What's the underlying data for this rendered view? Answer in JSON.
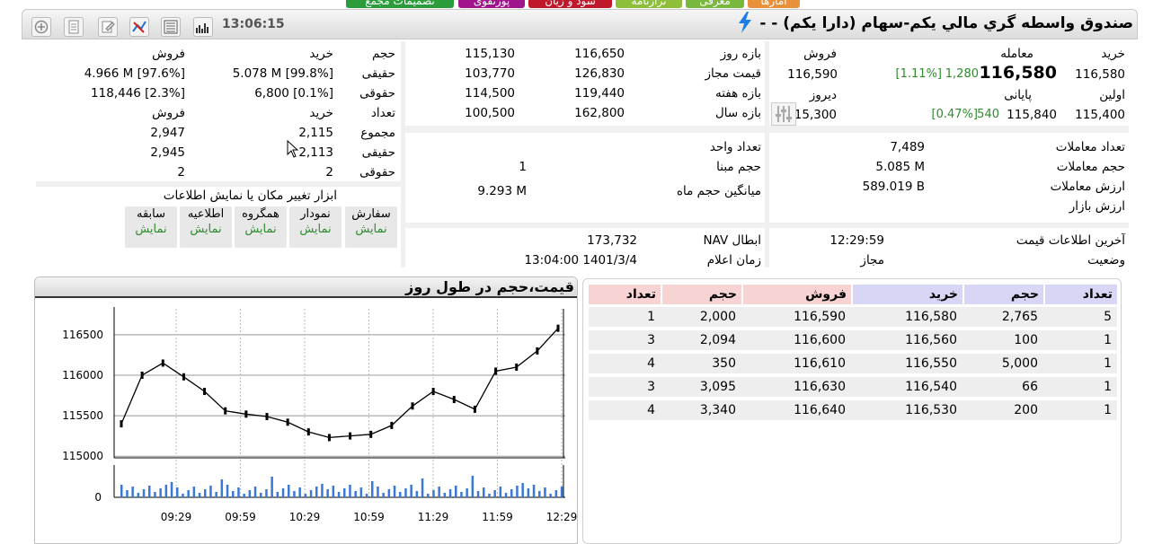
{
  "top_tabs": [
    {
      "label": "آمارها",
      "color": "#e8913a"
    },
    {
      "label": "معرفی",
      "color": "#78b83c"
    },
    {
      "label": "ترازنامه",
      "color": "#8dbf3a"
    },
    {
      "label": "سود و زیان",
      "color": "#c0182a"
    },
    {
      "label": "پورتفوی",
      "color": "#a0148c"
    },
    {
      "label": "تصمیمات مجمع",
      "color": "#2a9c3a"
    }
  ],
  "header": {
    "title": "صندوق واسطه گري مالي يكم-سهام (دارا يكم) - -",
    "time": "13:06:15",
    "toolbar_icons": [
      "plus-icon",
      "document-icon",
      "edit-icon",
      "chart-tools-icon",
      "list-icon",
      "bar-chart-icon"
    ]
  },
  "price_panel": {
    "col_buy_label": "خرید",
    "col_trade_label": "معامله",
    "col_sell_label": "فروش",
    "buy_value": "116,580",
    "trade_value": "116,580",
    "trade_change": "1,280",
    "trade_change_pct": "[1.11%]",
    "sell_value": "116,590",
    "first_label": "اولین",
    "first_value": "115,400",
    "final_label": "پایانی",
    "final_value": "115,840",
    "final_change": "540",
    "final_change_pct": "[0.47%]",
    "yesterday_label": "دیروز",
    "yesterday_value": "115,300"
  },
  "ranges": {
    "rows": [
      {
        "label": "بازه روز",
        "high": "116,650",
        "low": "115,130"
      },
      {
        "label": "قیمت مجاز",
        "high": "126,830",
        "low": "103,770"
      },
      {
        "label": "بازه هفته",
        "high": "119,440",
        "low": "114,500"
      },
      {
        "label": "بازه سال",
        "high": "162,800",
        "low": "100,500"
      }
    ]
  },
  "players": {
    "volume_label": "حجم",
    "buy_label": "خرید",
    "sell_label": "فروش",
    "real_label": "حقیقی",
    "legal_label": "حقوقی",
    "count_label": "تعداد",
    "total_label": "مجموع",
    "vol_real_buy": "5.078 M [99.8%]",
    "vol_real_sell": "4.966 M [97.6%]",
    "vol_legal_buy": "6,800 [0.1%]",
    "vol_legal_sell": "118,446 [2.3%]",
    "count_total_buy": "2,115",
    "count_total_sell": "2,947",
    "count_real_buy": "2,113",
    "count_real_sell": "2,945",
    "count_legal_buy": "2",
    "count_legal_sell": "2"
  },
  "trades": {
    "count_label": "تعداد معاملات",
    "count_value": "7,489",
    "volume_label": "حجم معاملات",
    "volume_value": "5.085 M",
    "value_label": "ارزش معاملات",
    "value_value": "589.019 B",
    "market_value_label": "ارزش بازار",
    "market_value_value": ""
  },
  "unit_info": {
    "unit_count_label": "تعداد واحد",
    "unit_count_value": "",
    "base_volume_label": "حجم مبنا",
    "base_volume_value": "1",
    "avg_month_label": "میانگین حجم ماه",
    "avg_month_value": "9.293 M"
  },
  "tools": {
    "title": "ابزار تغییر مکان یا نمایش اطلاعات",
    "buttons": [
      {
        "label": "سفارش",
        "state": "نمایش"
      },
      {
        "label": "نمودار",
        "state": "نمایش"
      },
      {
        "label": "همگروه",
        "state": "نمایش"
      },
      {
        "label": "اطلاعیه",
        "state": "نمایش"
      },
      {
        "label": "سابقه",
        "state": "نمایش"
      }
    ]
  },
  "nav_info": {
    "nav_label": "NAV ابطال",
    "nav_value": "173,732",
    "announce_label": "زمان اعلام",
    "announce_value": "13:04:00 1401/3/4"
  },
  "status_info": {
    "last_price_label": "آخرین اطلاعات قیمت",
    "last_price_value": "12:29:59",
    "status_label": "وضعیت",
    "status_value": "مجاز"
  },
  "order_book": {
    "headers": {
      "buy_count": "تعداد",
      "buy_volume": "حجم",
      "buy_price": "خرید",
      "sell_price": "فروش",
      "sell_volume": "حجم",
      "sell_count": "تعداد"
    },
    "rows": [
      {
        "buy_count": "5",
        "buy_volume": "2,765",
        "buy_price": "116,580",
        "sell_price": "116,590",
        "sell_volume": "2,000",
        "sell_count": "1"
      },
      {
        "buy_count": "1",
        "buy_volume": "100",
        "buy_price": "116,560",
        "sell_price": "116,600",
        "sell_volume": "2,094",
        "sell_count": "3"
      },
      {
        "buy_count": "1",
        "buy_volume": "5,000",
        "buy_price": "116,550",
        "sell_price": "116,610",
        "sell_volume": "350",
        "sell_count": "4"
      },
      {
        "buy_count": "1",
        "buy_volume": "66",
        "buy_price": "116,540",
        "sell_price": "116,630",
        "sell_volume": "3,095",
        "sell_count": "3"
      },
      {
        "buy_count": "1",
        "buy_volume": "200",
        "buy_price": "116,530",
        "sell_price": "116,640",
        "sell_volume": "3,340",
        "sell_count": "4"
      }
    ],
    "buy_header_color": "#d7d7f5",
    "sell_header_color": "#f7d3d3"
  },
  "chart_data": {
    "type": "line",
    "title": "قیمت،حجم در طول روز",
    "x_ticks": [
      "09:29",
      "09:59",
      "10:29",
      "10:59",
      "11:29",
      "11:59",
      "12:29"
    ],
    "y_ticks": [
      116500,
      116000,
      115500,
      115000
    ],
    "volume_ticks": [
      0
    ],
    "ylim": [
      114980,
      116820
    ],
    "x": [
      "09:05",
      "09:15",
      "09:25",
      "09:35",
      "09:45",
      "09:55",
      "10:05",
      "10:15",
      "10:25",
      "10:35",
      "10:45",
      "10:55",
      "11:05",
      "11:15",
      "11:25",
      "11:35",
      "11:45",
      "11:55",
      "12:05",
      "12:15",
      "12:25",
      "12:30"
    ],
    "series": [
      {
        "values": [
          115400,
          116000,
          116150,
          115980,
          115800,
          115560,
          115520,
          115490,
          115420,
          115300,
          115230,
          115250,
          115270,
          115380,
          115620,
          115800,
          115700,
          115580,
          116050,
          116100,
          116300,
          116580
        ]
      }
    ],
    "grid": true,
    "price_color": "#000000",
    "volume_color": "#3a78d8"
  }
}
